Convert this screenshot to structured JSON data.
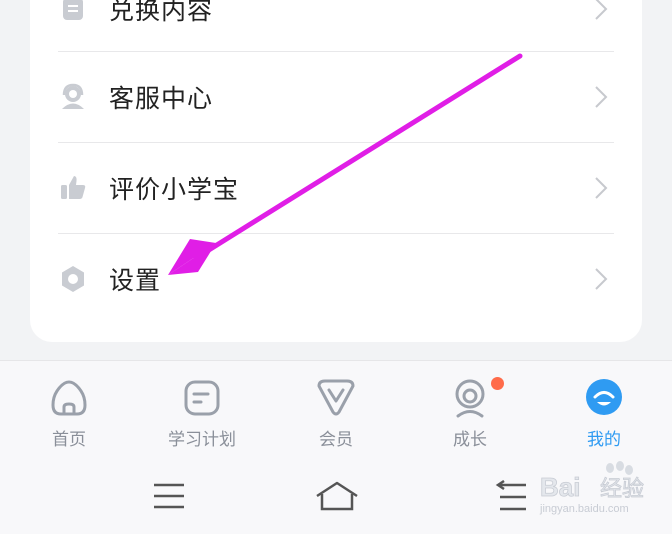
{
  "menu": {
    "items": [
      {
        "label": "兑换内容",
        "icon": "clipboard-icon"
      },
      {
        "label": "客服中心",
        "icon": "customer-service-icon"
      },
      {
        "label": "评价小学宝",
        "icon": "thumbs-up-icon"
      },
      {
        "label": "设置",
        "icon": "hexagon-settings-icon"
      }
    ]
  },
  "tabbar": {
    "tabs": [
      {
        "label": "首页",
        "icon": "home-icon",
        "active": false
      },
      {
        "label": "学习计划",
        "icon": "study-plan-icon",
        "active": false
      },
      {
        "label": "会员",
        "icon": "vip-icon",
        "active": false
      },
      {
        "label": "成长",
        "icon": "growth-icon",
        "active": false,
        "badge": true
      },
      {
        "label": "我的",
        "icon": "mine-icon",
        "active": true
      }
    ]
  },
  "colors": {
    "accent": "#2f9bf2",
    "inactive": "#8a8f99",
    "annotation_arrow": "#e01ee6",
    "badge": "#ff6b4a"
  },
  "system_nav": {
    "buttons": [
      "menu-icon",
      "home-icon",
      "back-icon"
    ]
  },
  "watermark": {
    "brand": "Bai",
    "brand2": "经验",
    "url": "jingyan.baidu.com"
  }
}
